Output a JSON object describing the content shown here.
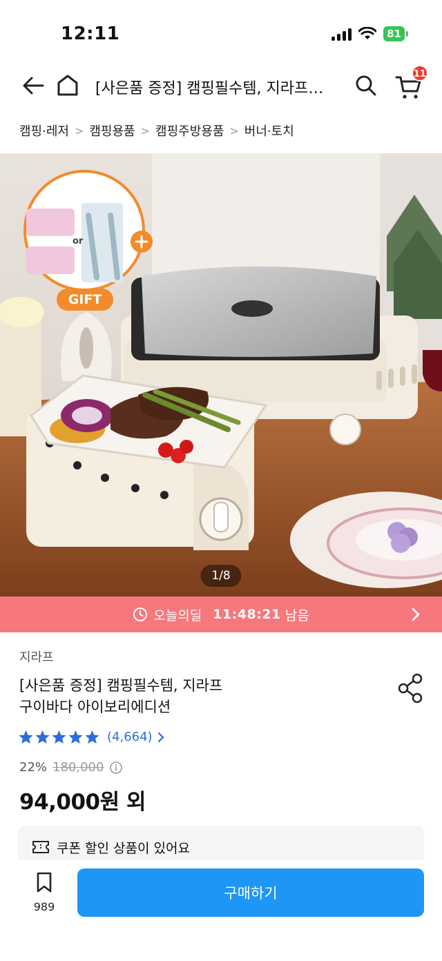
{
  "status_bar": {
    "time": "12:11",
    "battery": "81"
  },
  "header": {
    "title": "[사은품 증정] 캠핑필수템, 지라프…",
    "cart_count": "11"
  },
  "breadcrumb": [
    "캠핑·레저",
    "캠핑용품",
    "캠핑주방용품",
    "버너·토치"
  ],
  "hero": {
    "page_counter": "1/8",
    "gift_label": "GIFT",
    "gift_or": "or"
  },
  "deal": {
    "label": "오늘의딜",
    "timer": "11:48:21",
    "suffix": "남음"
  },
  "product": {
    "brand": "지라프",
    "name_line1": "[사은품 증정] 캠핑필수템, 지라프",
    "name_line2": "구이바다 아이보리에디션",
    "rating": 5,
    "review_count": "(4,664)",
    "discount": "22%",
    "original_price": "180,000",
    "final_price": "94,000원 외"
  },
  "coupon": {
    "text": "쿠폰 할인 상품이 있어요"
  },
  "bottom": {
    "wish_count": "989",
    "buy_label": "구매하기"
  },
  "colors": {
    "accent_blue": "#1e96f6",
    "deal_pink": "#f6777c",
    "star_blue": "#2a6fd8",
    "badge_red": "#f03a30",
    "battery_green": "#33c759"
  }
}
